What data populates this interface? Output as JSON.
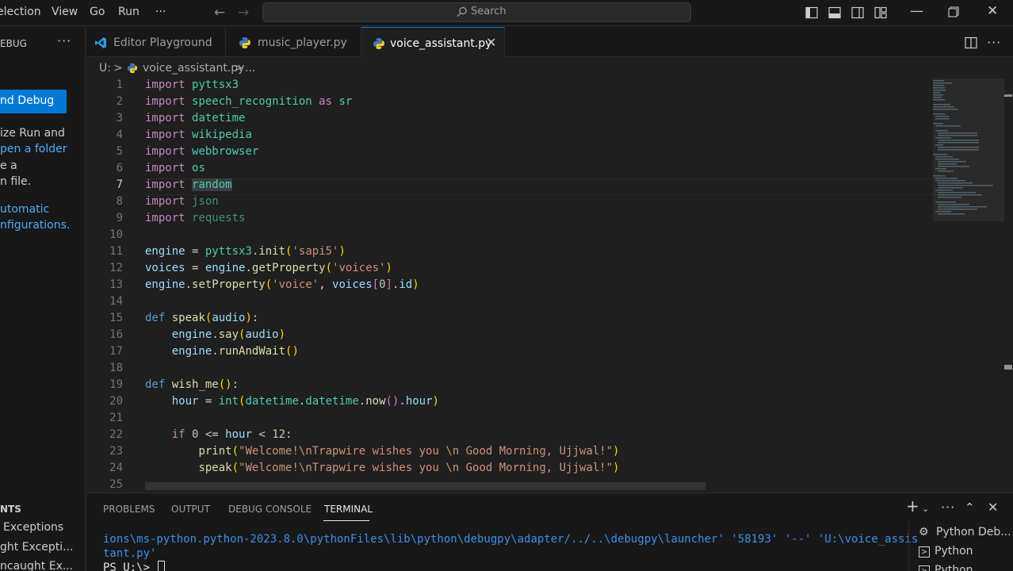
{
  "menubar": {
    "items": [
      "election",
      "View",
      "Go",
      "Run",
      "···"
    ],
    "search_placeholder": "Search"
  },
  "sidebar": {
    "header": "EBUG",
    "more": "···",
    "run_button": "nd Debug",
    "lines": [
      {
        "text": "ize Run and",
        "style": "plain"
      },
      {
        "text": "pen a folder",
        "style": "link"
      },
      {
        "text": "e a",
        "style": "plain"
      },
      {
        "text": "n file.",
        "style": "plain"
      },
      {
        "text": "utomatic",
        "style": "link"
      },
      {
        "text": "nfigurations.",
        "style": "link"
      }
    ],
    "breakpoints_header": "NTS",
    "breakpoints": [
      "Exceptions",
      "ght Excepti...",
      "ncaught Ex..."
    ]
  },
  "tabs": [
    {
      "label": "Editor Playground",
      "icon": "vscode-icon",
      "active": false
    },
    {
      "label": "music_player.py",
      "icon": "python-icon",
      "active": false
    },
    {
      "label": "voice_assistant.py",
      "icon": "python-icon",
      "active": true
    }
  ],
  "breadcrumb": {
    "drive": "U:",
    "sep": ">",
    "file": "voice_assistant.py",
    "more": "..."
  },
  "editor": {
    "current_line": 7,
    "line_numbers": [
      "1",
      "2",
      "3",
      "4",
      "5",
      "6",
      "7",
      "8",
      "9",
      "10",
      "11",
      "12",
      "13",
      "14",
      "15",
      "16",
      "17",
      "18",
      "19",
      "20",
      "21",
      "22",
      "23",
      "24",
      "25"
    ]
  },
  "panel": {
    "tabs": [
      "PROBLEMS",
      "OUTPUT",
      "DEBUG CONSOLE",
      "TERMINAL"
    ],
    "active_tab": "TERMINAL",
    "terminal_lines": [
      "ions\\ms-python.python-2023.8.0\\pythonFiles\\lib\\python\\debugpy\\adapter/../..\\debugpy\\launcher' '58193' '--' 'U:\\voice_assis",
      "tant.py'"
    ],
    "prompt": "PS U:\\> ",
    "terminals": [
      "Python Deb...",
      "Python",
      "Python"
    ]
  },
  "colors": {
    "accent": "#0078d4",
    "keyword": "#c586c0",
    "module": "#4ec9b0",
    "string": "#ce9178",
    "function": "#dcdcaa",
    "variable": "#9cdcfe"
  }
}
